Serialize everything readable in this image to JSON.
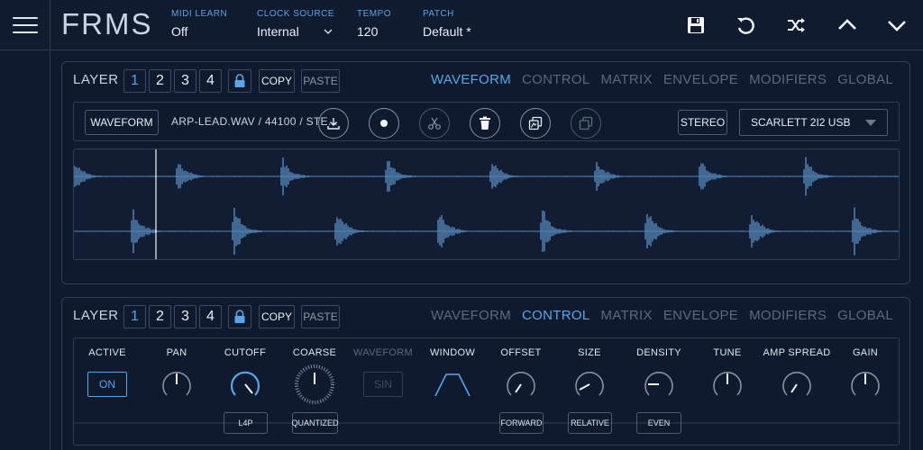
{
  "header": {
    "logo": "FRMS",
    "midi_learn": {
      "label": "MIDI LEARN",
      "value": "Off"
    },
    "clock_source": {
      "label": "CLOCK SOURCE",
      "value": "Internal"
    },
    "tempo": {
      "label": "TEMPO",
      "value": "120"
    },
    "patch": {
      "label": "PATCH",
      "value": "Default *"
    },
    "icons": [
      "save-icon",
      "undo-icon",
      "shuffle-icon",
      "chevron-up-icon",
      "chevron-down-icon"
    ]
  },
  "layer1": {
    "title": "LAYER",
    "numbers": [
      "1",
      "2",
      "3",
      "4"
    ],
    "active_number": "1",
    "copy_label": "COPY",
    "paste_label": "PASTE",
    "tabs": [
      "WAVEFORM",
      "CONTROL",
      "MATRIX",
      "ENVELOPE",
      "MODIFIERS",
      "GLOBAL"
    ],
    "active_tab": "WAVEFORM",
    "waveform_button": "WAVEFORM",
    "filename": "ARP-LEAD.WAV / 44100 / STE...",
    "stereo_button": "STEREO",
    "device_select": "SCARLETT 2I2 USB"
  },
  "layer2": {
    "title": "LAYER",
    "numbers": [
      "1",
      "2",
      "3",
      "4"
    ],
    "active_number": "1",
    "copy_label": "COPY",
    "paste_label": "PASTE",
    "tabs": [
      "WAVEFORM",
      "CONTROL",
      "MATRIX",
      "ENVELOPE",
      "MODIFIERS",
      "GLOBAL"
    ],
    "active_tab": "CONTROL",
    "controls": {
      "active": {
        "label": "ACTIVE",
        "value": "ON"
      },
      "pan": {
        "label": "PAN"
      },
      "cutoff": {
        "label": "CUTOFF",
        "tag": "L4P"
      },
      "coarse": {
        "label": "COARSE",
        "tag": "QUANTIZED"
      },
      "waveform": {
        "label": "WAVEFORM",
        "value": "SIN"
      },
      "window": {
        "label": "WINDOW"
      },
      "offset": {
        "label": "OFFSET",
        "tag": "FORWARD"
      },
      "size": {
        "label": "SIZE",
        "tag": "RELATIVE"
      },
      "density": {
        "label": "DENSITY",
        "tag": "EVEN"
      },
      "tune": {
        "label": "TUNE"
      },
      "amp_spread": {
        "label": "AMP SPREAD"
      },
      "gain": {
        "label": "GAIN"
      }
    }
  },
  "colors": {
    "accent": "#5aa5e8",
    "background": "#0f1a2e",
    "border": "#2e3e58"
  }
}
